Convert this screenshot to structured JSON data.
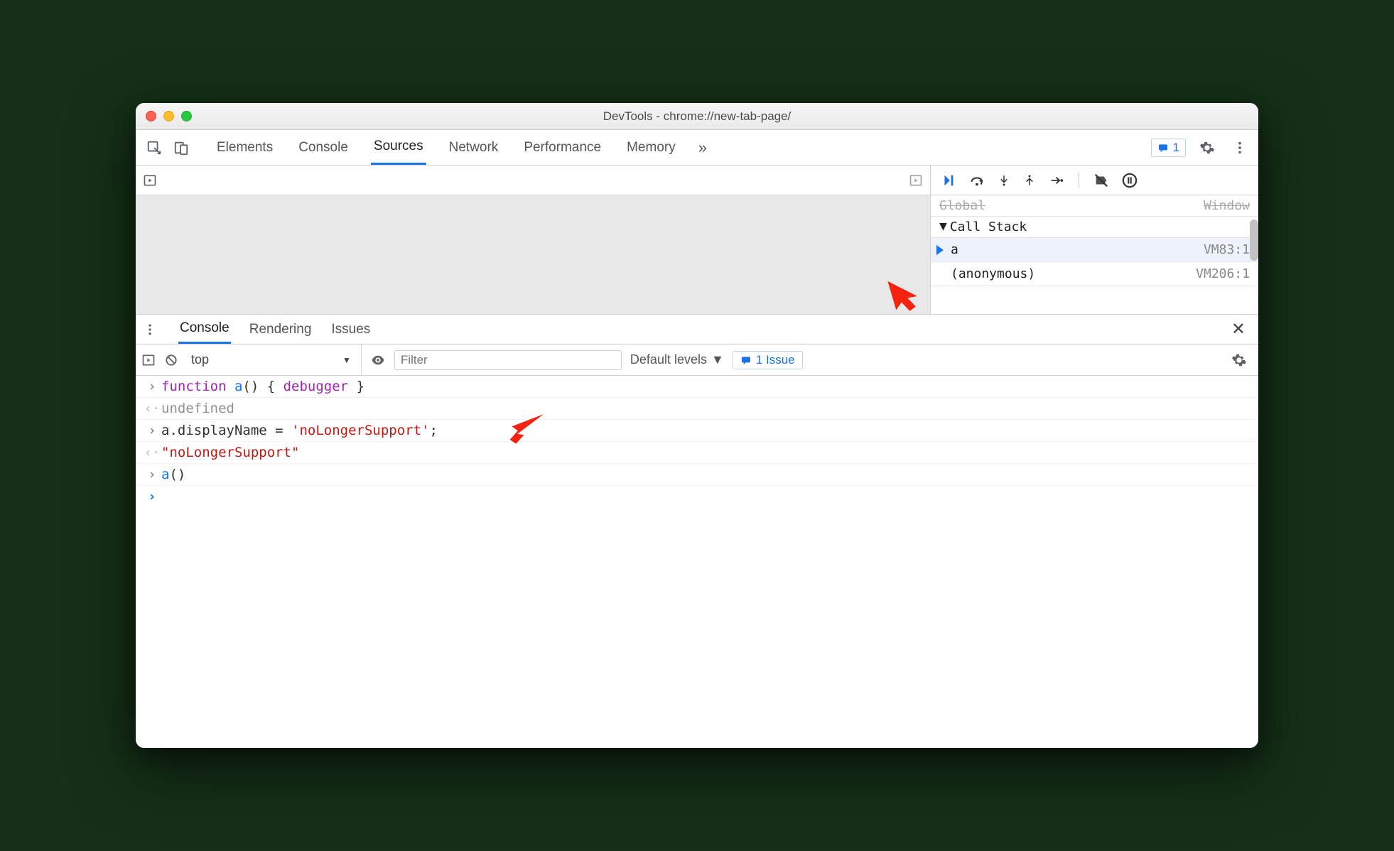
{
  "window": {
    "title": "DevTools - chrome://new-tab-page/"
  },
  "mainTabs": {
    "items": [
      "Elements",
      "Console",
      "Sources",
      "Network",
      "Performance",
      "Memory"
    ],
    "activeIndex": 2,
    "moreGlyph": "»",
    "badgeCount": "1"
  },
  "debugger": {
    "globalLabel": "Global",
    "globalValue": "Window",
    "callStackHeader": "Call Stack",
    "stack": [
      {
        "fn": "a",
        "loc": "VM83:1",
        "active": true
      },
      {
        "fn": "(anonymous)",
        "loc": "VM206:1",
        "active": false
      }
    ]
  },
  "drawer": {
    "tabs": [
      "Console",
      "Rendering",
      "Issues"
    ],
    "activeIndex": 0
  },
  "consoleToolbar": {
    "context": "top",
    "filterPlaceholder": "Filter",
    "levels": "Default levels",
    "issuesChip": "1 Issue"
  },
  "consoleLines": {
    "l0_kw1": "function",
    "l0_fn": " a",
    "l0_rest": "() { ",
    "l0_kw2": "debugger",
    "l0_rest2": " }",
    "l1": "undefined",
    "l2_a": "a.displayName = ",
    "l2_str": "'noLongerSupport'",
    "l2_b": ";",
    "l3": "\"noLongerSupport\"",
    "l4_fn": "a",
    "l4_rest": "()"
  },
  "gutters": {
    "in": "›",
    "out": "‹·",
    "prompt": "›"
  },
  "colors": {
    "accent": "#1a73e8",
    "annotation": "#f4220f"
  }
}
